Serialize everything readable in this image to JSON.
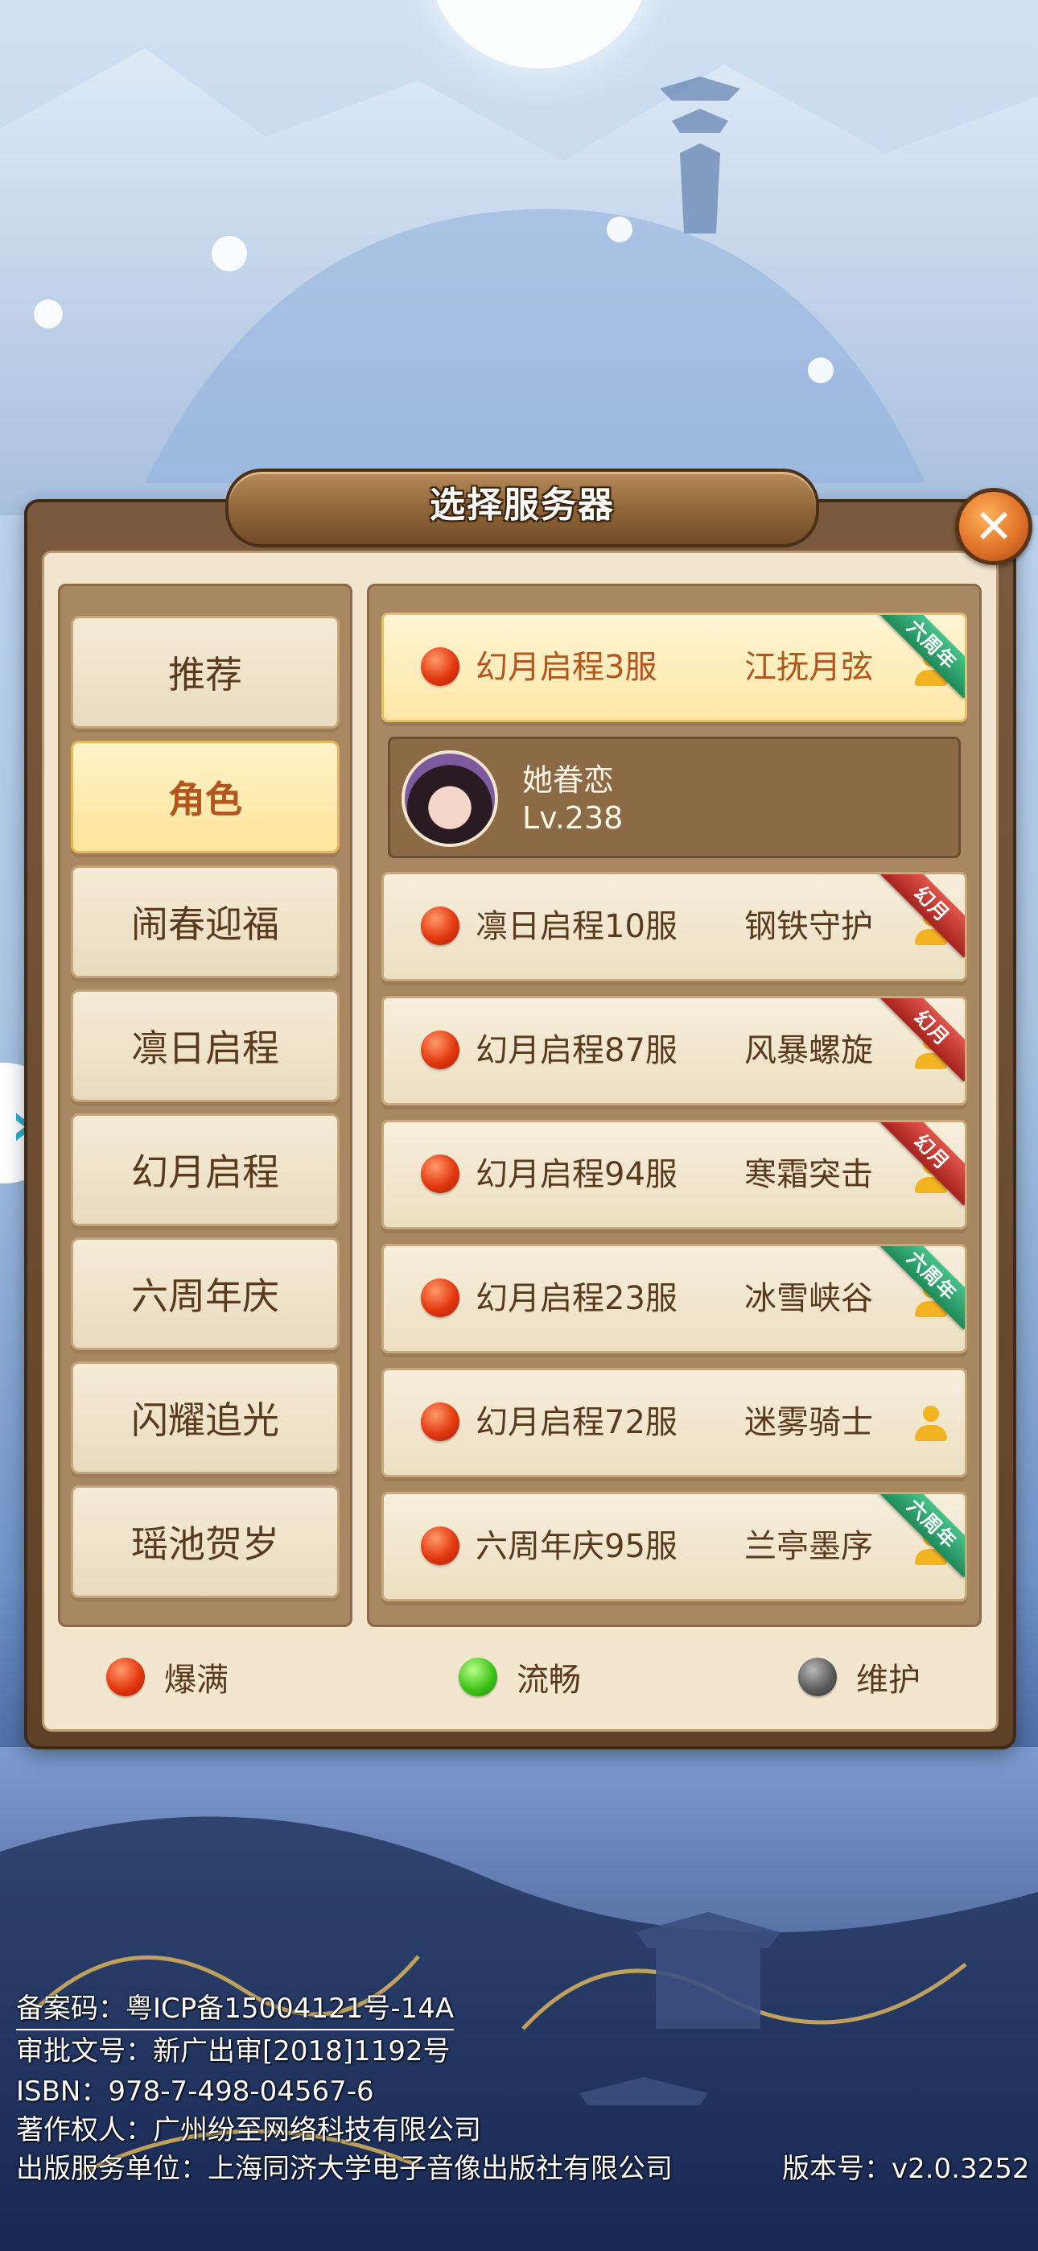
{
  "dialog": {
    "title": "选择服务器"
  },
  "tabs": [
    {
      "label": "推荐",
      "active": false
    },
    {
      "label": "角色",
      "active": true
    },
    {
      "label": "闹春迎福",
      "active": false
    },
    {
      "label": "凛日启程",
      "active": false
    },
    {
      "label": "幻月启程",
      "active": false
    },
    {
      "label": "六周年庆",
      "active": false
    },
    {
      "label": "闪耀追光",
      "active": false
    },
    {
      "label": "瑶池贺岁",
      "active": false
    }
  ],
  "servers": [
    {
      "name": "幻月启程3服",
      "role": "江抚月弦",
      "status": "爆满",
      "ribbon": "六周年",
      "ribbon_color": "#2ea36d",
      "selected": true
    },
    {
      "name": "凛日启程10服",
      "role": "钢铁守护",
      "status": "爆满",
      "ribbon": "幻月",
      "ribbon_color": "#c4332c",
      "selected": false
    },
    {
      "name": "幻月启程87服",
      "role": "风暴螺旋",
      "status": "爆满",
      "ribbon": "幻月",
      "ribbon_color": "#c4332c",
      "selected": false
    },
    {
      "name": "幻月启程94服",
      "role": "寒霜突击",
      "status": "爆满",
      "ribbon": "幻月",
      "ribbon_color": "#c4332c",
      "selected": false
    },
    {
      "name": "幻月启程23服",
      "role": "冰雪峡谷",
      "status": "爆满",
      "ribbon": "六周年",
      "ribbon_color": "#2ea36d",
      "selected": false
    },
    {
      "name": "幻月启程72服",
      "role": "迷雾骑士",
      "status": "爆满",
      "ribbon": "",
      "ribbon_color": "",
      "selected": false
    },
    {
      "name": "六周年庆95服",
      "role": "兰亭墨序",
      "status": "爆满",
      "ribbon": "六周年",
      "ribbon_color": "#2ea36d",
      "selected": false
    }
  ],
  "character": {
    "name": "她眷恋",
    "level": "Lv.238"
  },
  "legend": {
    "full": {
      "label": "爆满",
      "color": "#e3380f"
    },
    "smooth": {
      "label": "流畅",
      "color": "#3fc41a"
    },
    "maintenance": {
      "label": "维护",
      "color": "#5d5d5d"
    }
  },
  "footer": {
    "record": "备案码：粤ICP备15004121号-14A",
    "approval": "审批文号：新广出审[2018]1192号",
    "isbn": "ISBN：978-7-498-04567-6",
    "copyright": "著作权人：广州纷至网络科技有限公司",
    "publisher": "出版服务单位：上海同济大学电子音像出版社有限公司",
    "version": "版本号：v2.0.3252"
  },
  "icons": {
    "close": "close-icon",
    "side_arrow": "double-chevron-right-icon",
    "person": "person-icon"
  }
}
